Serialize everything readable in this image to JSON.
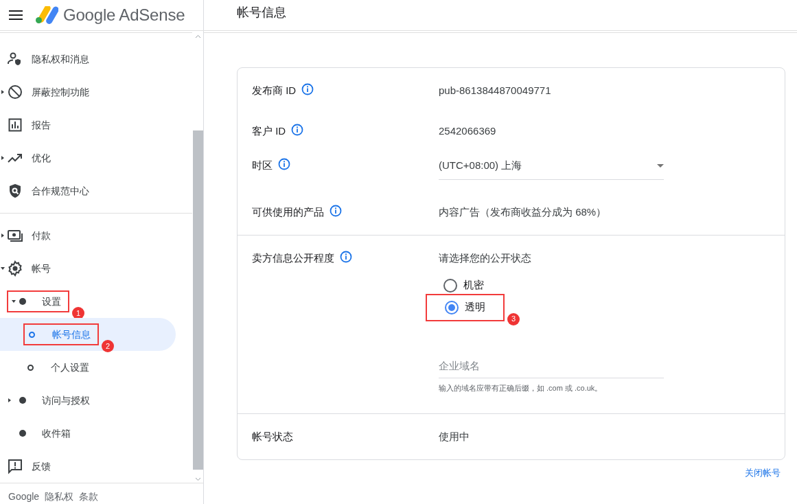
{
  "header": {
    "brand": "Google AdSense",
    "title": "帐号信息"
  },
  "sidebar": {
    "groups": [
      {
        "items": [
          {
            "label": "隐私权和消息",
            "selected": false
          },
          {
            "label": "屏蔽控制功能",
            "selected": false,
            "expanded": false
          },
          {
            "label": "报告",
            "selected": false
          },
          {
            "label": "优化",
            "selected": false,
            "expanded": false
          },
          {
            "label": "合作规范中心",
            "selected": false
          }
        ]
      },
      {
        "items": [
          {
            "label": "付款",
            "selected": false,
            "expanded": false
          },
          {
            "label": "帐号",
            "selected": false,
            "expanded": true,
            "children": [
              {
                "label": "设置",
                "selected": false,
                "expanded": true,
                "annotation": "1",
                "children": [
                  {
                    "label": "帐号信息",
                    "selected": true,
                    "annotation": "2"
                  },
                  {
                    "label": "个人设置",
                    "selected": false
                  }
                ]
              },
              {
                "label": "访问与授权",
                "selected": false,
                "expanded": false
              },
              {
                "label": "收件箱",
                "selected": false
              }
            ]
          },
          {
            "label": "反馈",
            "selected": false
          }
        ]
      }
    ],
    "footer": [
      "Google",
      "隐私权",
      "条款"
    ]
  },
  "card": {
    "rows": [
      {
        "kind": "text",
        "label": "发布商 ID",
        "info": true,
        "value": "pub-8613844870049771"
      },
      {
        "kind": "text",
        "label": "客户 ID",
        "info": true,
        "value": "2542066369"
      },
      {
        "kind": "select",
        "label": "时区",
        "info": true,
        "value": "(UTC+08:00) 上海"
      },
      {
        "kind": "text",
        "label": "可供使用的产品",
        "info": true,
        "value": "内容广告（发布商收益分成为 68%）"
      },
      {
        "kind": "radio",
        "label": "卖方信息公开程度",
        "info": true,
        "prompt": "请选择您的公开状态",
        "options": [
          {
            "label": "机密",
            "selected": false
          },
          {
            "label": "透明",
            "selected": true,
            "annotation": "3"
          }
        ],
        "field": {
          "placeholder": "企业域名",
          "hint": "输入的域名应带有正确后缀，如 .com 或 .co.uk。"
        }
      },
      {
        "kind": "text",
        "label": "帐号状态",
        "info": false,
        "value": "使用中"
      }
    ]
  },
  "close_link": "关闭帐号"
}
